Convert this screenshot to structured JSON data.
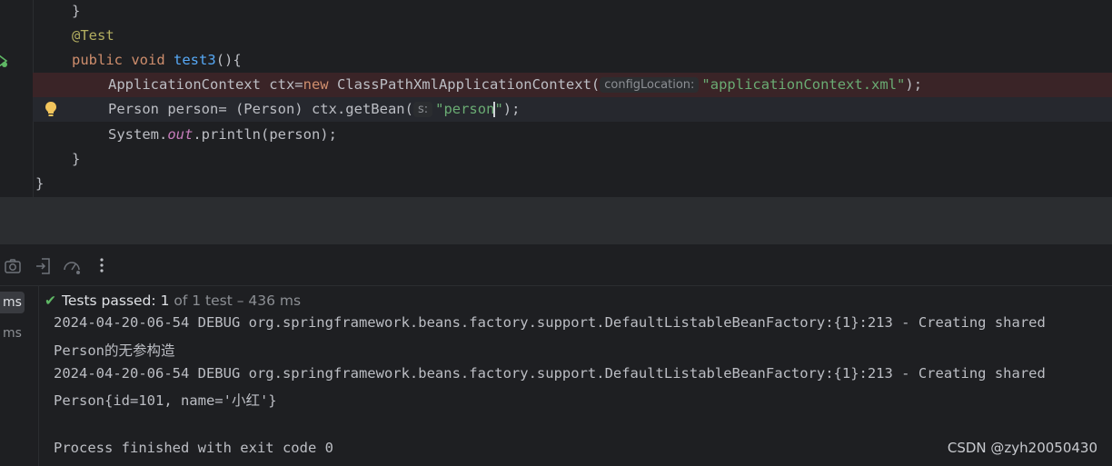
{
  "editor": {
    "lines": {
      "close_brace_1": "}",
      "annotation": "@Test",
      "method_public": "public",
      "method_void": "void",
      "method_name": "test3",
      "method_tail": "(){",
      "ctx_type": "ApplicationContext ctx=",
      "ctx_new": "new",
      "ctx_class": " ClassPathXmlApplicationContext(",
      "ctx_hint": "configLocation:",
      "ctx_arg": "\"applicationContext.xml\"",
      "ctx_tail": ");",
      "person_decl": "Person person= (Person) ctx.getBean(",
      "person_hint": "s:",
      "person_arg_a": "\"person",
      "person_arg_b": "\"",
      "person_tail": ");",
      "println_a": "System.",
      "println_field": "out",
      "println_b": ".println(person);",
      "close_brace_2": "}",
      "close_brace_3": "}"
    }
  },
  "tests": {
    "status_prefix": "Tests passed:",
    "passed_count": "1",
    "status_suffix": "of 1 test – 436 ms",
    "left_items": [
      "ms",
      "ms"
    ]
  },
  "console": {
    "lines": [
      "2024-04-20-06-54 DEBUG org.springframework.beans.factory.support.DefaultListableBeanFactory:{1}:213 - Creating shared",
      "Person的无参构造",
      "2024-04-20-06-54 DEBUG org.springframework.beans.factory.support.DefaultListableBeanFactory:{1}:213 - Creating shared",
      "Person{id=101, name='小红'}",
      "",
      "Process finished with exit code 0"
    ]
  },
  "watermark": "CSDN @zyh20050430",
  "icons": [
    "run-gutter-icon",
    "bulb-icon",
    "camera-icon",
    "import-icon",
    "speed-icon",
    "more-icon",
    "check-icon"
  ]
}
